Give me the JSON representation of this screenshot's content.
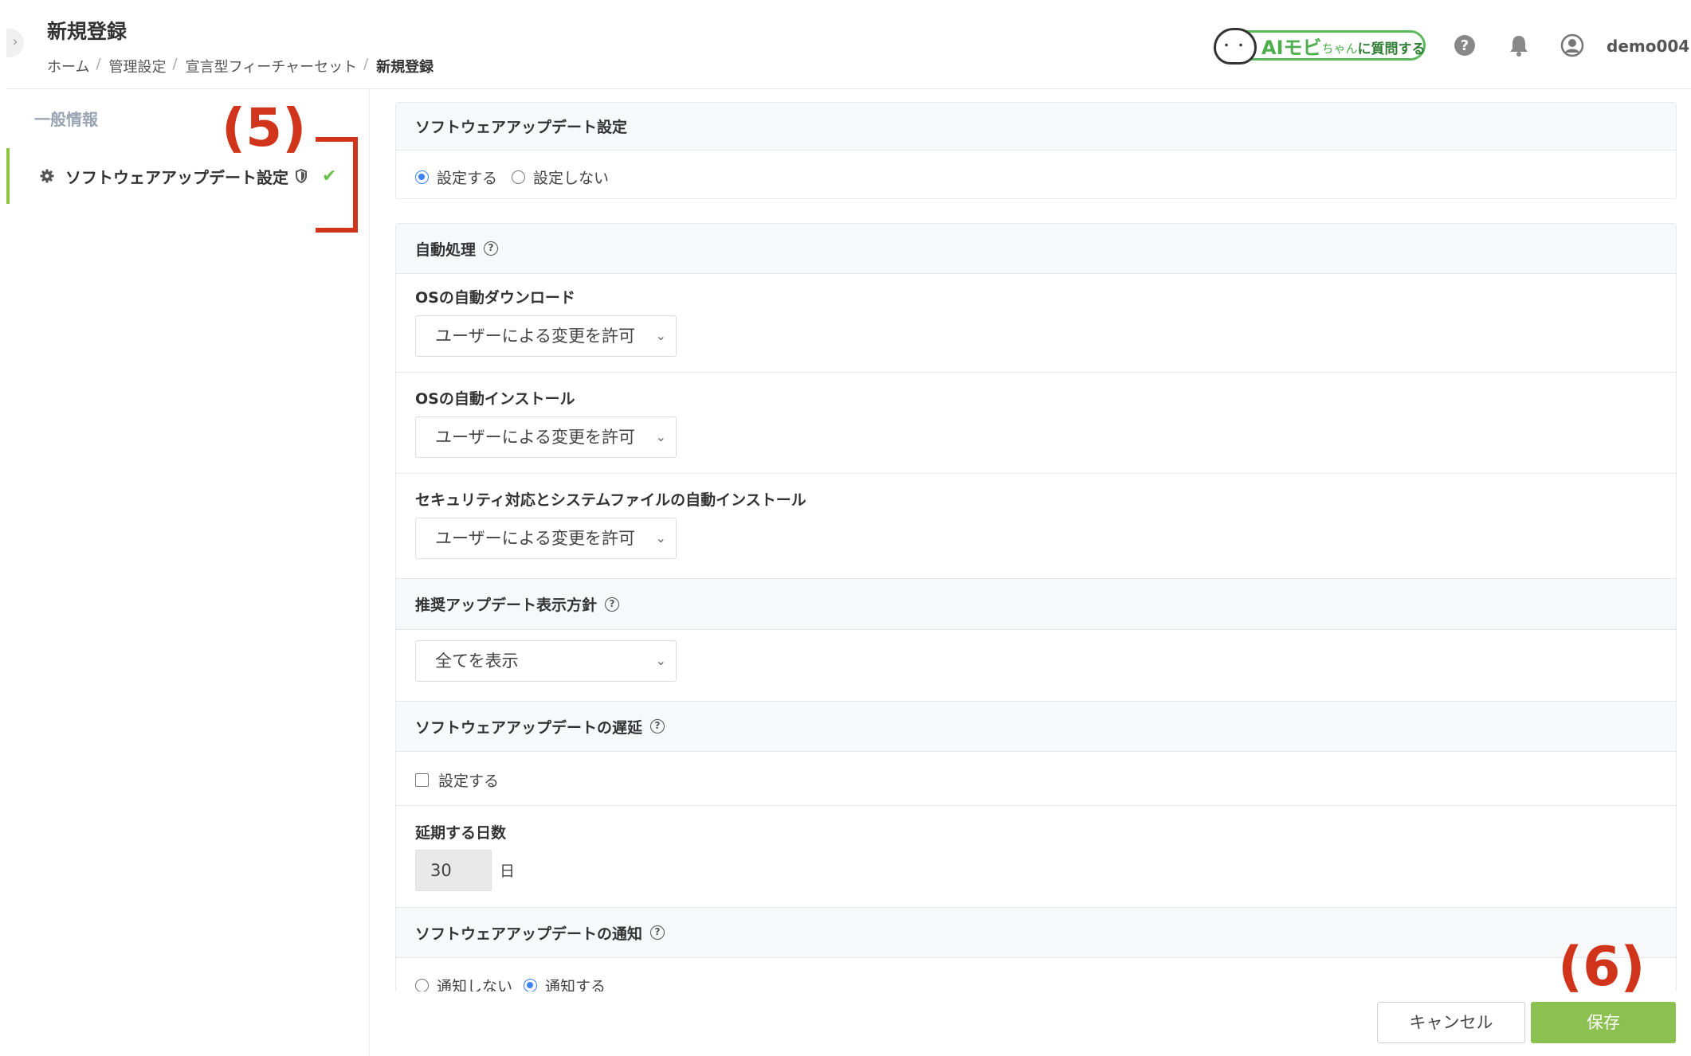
{
  "header": {
    "title": "新規登録",
    "breadcrumb": [
      "ホーム",
      "管理設定",
      "宣言型フィーチャーセット",
      "新規登録"
    ],
    "ai_button": {
      "face": "・・",
      "big": "AIモビ",
      "small": "ちゃん",
      "suffix": "に質問する"
    },
    "username": "demo004",
    "icons": [
      "help-icon",
      "bell-icon",
      "user-icon"
    ]
  },
  "sidebar": {
    "heading": "一般情報",
    "items": [
      {
        "label": "ソフトウェアアップデート設定",
        "icon": "gear-icon",
        "badge": "shield-icon",
        "status": "check-icon"
      }
    ]
  },
  "annotations": {
    "five": "(5)",
    "six": "(6)"
  },
  "main": {
    "software_update": {
      "title": "ソフトウェアアップデート設定",
      "options": [
        "設定する",
        "設定しない"
      ],
      "selected": "設定する"
    },
    "auto_processing": {
      "title": "自動処理",
      "fields": [
        {
          "label": "OSの自動ダウンロード",
          "value": "ユーザーによる変更を許可"
        },
        {
          "label": "OSの自動インストール",
          "value": "ユーザーによる変更を許可"
        },
        {
          "label": "セキュリティ対応とシステムファイルの自動インストール",
          "value": "ユーザーによる変更を許可"
        }
      ]
    },
    "recommended_policy": {
      "title": "推奨アップデート表示方針",
      "value": "全てを表示"
    },
    "delay": {
      "title": "ソフトウェアアップデートの遅延",
      "checkbox_label": "設定する",
      "checked": false
    },
    "deferral_days": {
      "label": "延期する日数",
      "value": "30",
      "unit": "日"
    },
    "notification": {
      "title": "ソフトウェアアップデートの通知",
      "options": [
        "通知しない",
        "通知する"
      ],
      "selected": "通知する"
    }
  },
  "footer": {
    "cancel": "キャンセル",
    "save": "保存"
  },
  "colors": {
    "accent_green": "#8cc152",
    "annotation_red": "#d0351b",
    "radio_blue": "#3b82f6"
  }
}
